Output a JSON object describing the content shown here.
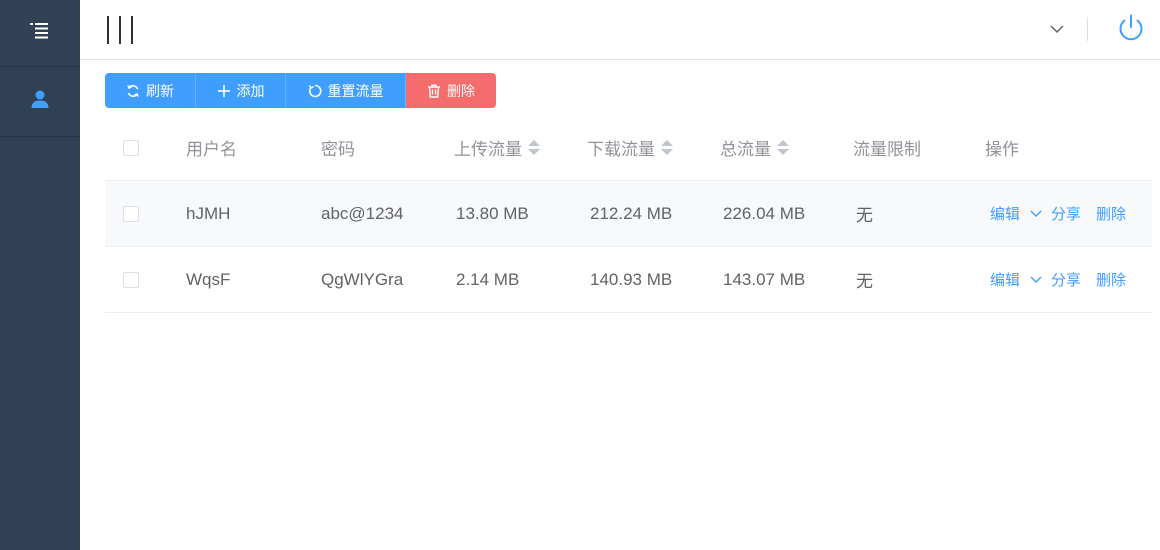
{
  "header": {
    "user_dropdown_icon": "chevron-down-icon",
    "power_icon": "power-icon",
    "hamburger_icon": "hamburger-icon"
  },
  "sidebar": {
    "items": [
      {
        "icon": "list-menu-icon"
      },
      {
        "icon": "user-icon"
      }
    ]
  },
  "toolbar": {
    "refresh_label": "刷新",
    "add_label": "添加",
    "reset_label": "重置流量",
    "delete_label": "删除"
  },
  "table": {
    "headers": {
      "username": "用户名",
      "password": "密码",
      "upload": "上传流量",
      "download": "下载流量",
      "total": "总流量",
      "limit": "流量限制",
      "ops": "操作"
    },
    "rows": [
      {
        "username": "hJMH",
        "password": "abc@1234",
        "upload": "13.80 MB",
        "download": "212.24 MB",
        "total": "226.04 MB",
        "limit": "无",
        "edit": "编辑",
        "share": "分享",
        "delete": "删除"
      },
      {
        "username": "WqsF",
        "password": "QgWlYGra",
        "upload": "2.14 MB",
        "download": "140.93 MB",
        "total": "143.07 MB",
        "limit": "无",
        "edit": "编辑",
        "share": "分享",
        "delete": "删除"
      }
    ]
  },
  "colors": {
    "sidebar_bg": "#304156",
    "primary": "#409eff",
    "danger": "#f56c6c",
    "text": "#606266",
    "header_text": "#909399"
  }
}
